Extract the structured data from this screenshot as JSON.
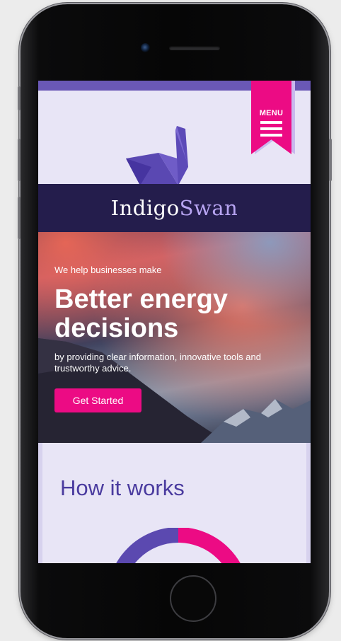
{
  "colors": {
    "accent_pink": "#ec0b84",
    "brand_indigo": "#241d4c",
    "brand_purple": "#6a58b6",
    "swan_violet": "#b7a4f1",
    "page_lavender": "#e8e5f6"
  },
  "header": {
    "menu_label": "MENU",
    "menu_icon": "hamburger-icon",
    "logo_icon": "swan-icon",
    "brand_part1": "Indigo",
    "brand_part2": "Swan"
  },
  "hero": {
    "subtitle": "We help businesses make",
    "title": "Better energy decisions",
    "description": "by providing clear information, innovative tools and trustworthy advice.",
    "cta_label": "Get Started"
  },
  "how_it_works": {
    "title": "How it works"
  }
}
